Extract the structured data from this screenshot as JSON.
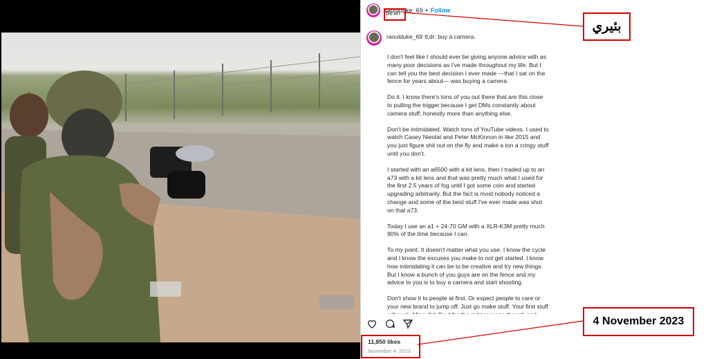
{
  "post": {
    "username": "raoulduke_69",
    "separator": "•",
    "follow_label": "Follow",
    "location": "Be'eri",
    "caption_lead": "tl;dr: buy a camera.",
    "paragraphs": [
      "I don't feel like I should ever be giving anyone advice with as many poor decisions as I've made throughout my life. But I can tell you the best decision I ever made —that I sat on the fence for years about— was buying a camera.",
      "Do it. I know there's tons of you out there that are this close to pulling the trigger because I get DMs constantly about camera stuff, honestly more than anything else.",
      "Don't be intimidated. Watch tons of YouTube videos. I used to watch Casey Niestat and Peter McKinnon in like 2015 and you just figure shit out on the fly and make a ton a cringy stuff until you don't.",
      "I started with an a6500 with a kit lens, then I traded up to an a73 with a kit lens and that was pretty much what I used for the first 2.5 years of fog until I got some coin and started upgrading arbitrarily. But the fact is most nobody noticed a change and some of the best stuff I've ever made was shot on that a73.",
      "Today I use an a1 + 24-70 GM with a XLR-K3M pretty much 90% of the time because I can.",
      "To my point. It doesn't matter what you use. I know the cycle and I know the excuses you make to not get started. I know how intimidating it can be to be creative and try new things. But I know a bunch of you guys are on the fence and my advice to you is to buy a camera and start shooting.",
      "Don't show it to people at first. Or expect people to care or your new brand to jump off. Just go make stuff. Your first stuff will suck. Mine did. Do it for the right reasons though and when you make things that you want, for you, how you see them in your"
    ],
    "likes": "11,850 likes",
    "date": "November 4, 2023"
  },
  "icons": [
    "heart-icon",
    "comment-icon",
    "share-icon",
    "person-tag-icon"
  ],
  "annotations": {
    "location_label": "بئيري",
    "date_label": "4 November 2023"
  },
  "colors": {
    "highlight": "#d40000",
    "link": "#0095f6"
  }
}
